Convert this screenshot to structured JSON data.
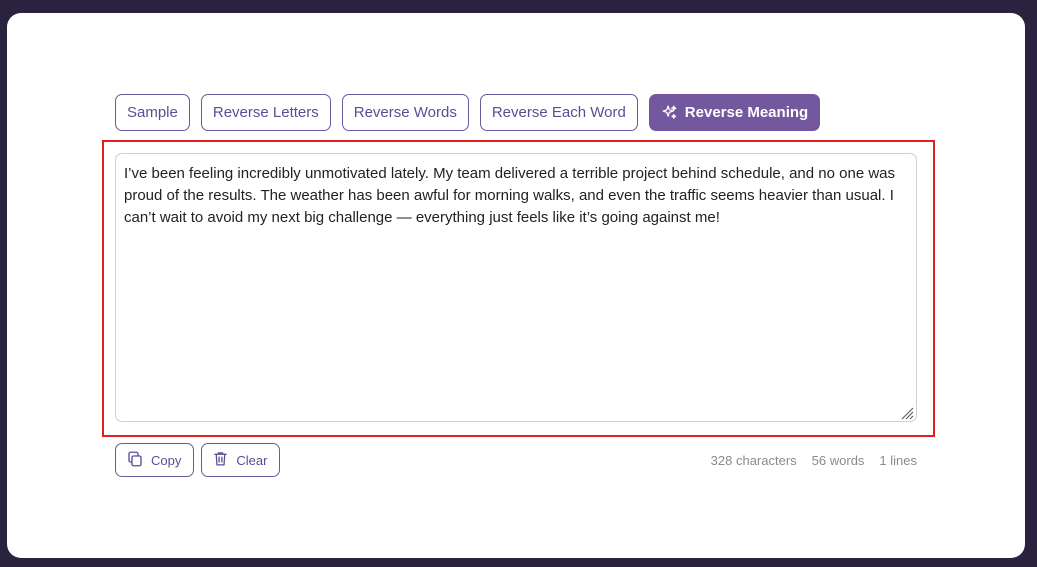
{
  "toolbar": {
    "buttons": [
      {
        "label": "Sample"
      },
      {
        "label": "Reverse Letters"
      },
      {
        "label": "Reverse Words"
      },
      {
        "label": "Reverse Each Word"
      },
      {
        "label": "Reverse Meaning",
        "icon": "sparkles-icon",
        "active": true
      }
    ]
  },
  "editor": {
    "text": "I’ve been feeling incredibly unmotivated lately. My team delivered a terrible project behind schedule, and no one was proud of the results. The weather has been awful for morning walks, and even the traffic seems heavier than usual. I can’t wait to avoid my next big challenge — everything just feels like it’s going against me!"
  },
  "actions": {
    "copy_label": "Copy",
    "copy_icon": "copy-icon",
    "clear_label": "Clear",
    "clear_icon": "trash-icon"
  },
  "stats": {
    "characters": "328 characters",
    "words": "56 words",
    "lines": "1 lines"
  },
  "colors": {
    "accent": "#73589f",
    "highlight_border": "#e0201f",
    "background": "#2a2340"
  }
}
